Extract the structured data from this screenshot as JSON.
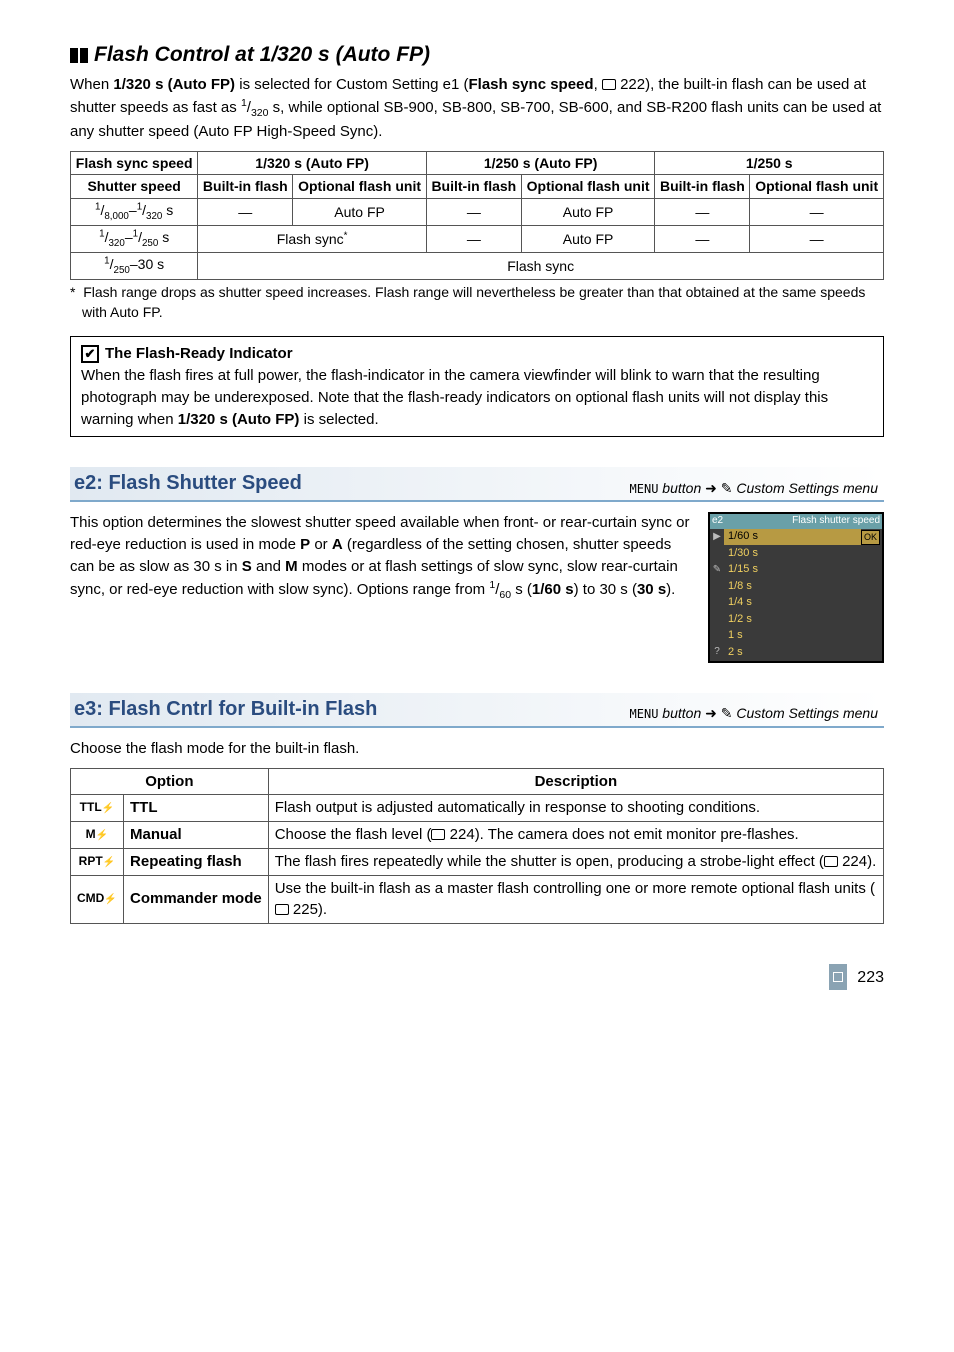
{
  "section1": {
    "title": "Flash Control at 1/320 s (Auto FP)",
    "para_parts": {
      "p1": "When ",
      "p2": " is selected for Custom Setting e1 (",
      "p3": ", ",
      "p4": " 222), the built-in flash can be used at shutter speeds as fast as ",
      "p5": " s, while optional SB-900, SB-800, SB-700, SB-600, and SB-R200 flash units can be used at any shutter speed (Auto FP High-Speed Sync).",
      "bold1": "1/320 s (Auto FP)",
      "bold2": "Flash sync speed",
      "frac_num": "1",
      "frac_den": "320"
    },
    "table": {
      "h_sync": "Flash sync speed",
      "h_shutter": "Shutter speed",
      "h_builtin": "Built-in flash",
      "h_optunit": "Optional flash unit",
      "c_auto320": "1/320 s (Auto FP)",
      "c_auto250": "1/250 s (Auto FP)",
      "c_250": "1/250 s",
      "r1_label_a": "1",
      "r1_label_b": "8,000",
      "r1_label_c": "1",
      "r1_label_d": "320",
      "r1_label_e": " s",
      "r2_label_a": "1",
      "r2_label_b": "320",
      "r2_label_c": "1",
      "r2_label_d": "250",
      "r2_label_e": " s",
      "r3_label_a": "1",
      "r3_label_b": "250",
      "r3_label_c": "–30 s",
      "dash": "—",
      "autoFP": "Auto FP",
      "flashsync": "Flash sync",
      "flashsync_star": "Flash sync"
    },
    "footnote_star": "*",
    "footnote": "Flash range drops as shutter speed increases.  Flash range will nevertheless be greater than that obtained at the same speeds with Auto FP."
  },
  "callout": {
    "title": "The Flash-Ready Indicator",
    "body_a": "When the flash fires at full power, the flash-indicator in the camera viewfinder will blink to warn that the resulting photograph may be underexposed.  Note that the flash-ready indicators on optional flash units will not display this warning when ",
    "body_bold": "1/320 s (Auto FP)",
    "body_b": " is selected."
  },
  "e2": {
    "name": "e2: Flash Shutter Speed",
    "loc_menu": "MENU",
    "loc_button": " button ",
    "loc_menu2": " Custom Settings menu",
    "para_a": "This option determines the slowest shutter speed available when front- or rear-curtain sync or red-eye reduction is used in mode ",
    "para_b": " or ",
    "para_c": " (regardless of the setting chosen, shutter speeds can be as slow as 30 s in ",
    "para_d": " and ",
    "para_e": " modes or at flash settings of slow sync, slow rear-curtain sync, or red-eye reduction with slow sync).  Options range from ",
    "P": "P",
    "A": "A",
    "S": "S",
    "M": "M",
    "frac_num": "1",
    "frac_den": "60",
    "para_f": " s (",
    "bold1": "1/60 s",
    "para_g": ") to 30 s (",
    "bold2": "30 s",
    "para_h": ").",
    "lcd": {
      "tag": "e2",
      "title": "Flash shutter speed",
      "items": [
        "1/60 s",
        "1/30 s",
        "1/15 s",
        "1/8 s",
        "1/4 s",
        "1/2 s",
        "1 s",
        "2 s"
      ],
      "ok": "OK"
    }
  },
  "e3": {
    "name": "e3: Flash Cntrl for Built-in Flash",
    "loc_menu": "MENU",
    "loc_button": " button ",
    "loc_menu2": " Custom Settings menu",
    "intro": "Choose the flash mode for the built-in flash.",
    "th_option": "Option",
    "th_desc": "Description",
    "rows": [
      {
        "code": "TTL",
        "label": "TTL",
        "desc": "Flash output is adjusted automatically in response to shooting conditions."
      },
      {
        "code": "M",
        "label": "Manual",
        "desc_a": "Choose the flash level (",
        "ref": " 224",
        "desc_b": "). The camera does not emit monitor pre-flashes."
      },
      {
        "code": "RPT",
        "label": "Repeating flash",
        "desc_a": "The flash fires repeatedly while the shutter is open, producing a strobe-light effect (",
        "ref": " 224",
        "desc_b": ")."
      },
      {
        "code": "CMD",
        "label": "Commander mode",
        "desc_a": "Use the built-in flash as a master flash controlling one or more remote optional flash units (",
        "ref": " 225",
        "desc_b": ")."
      }
    ]
  },
  "page_number": "223",
  "chart_data": {
    "type": "table",
    "title": "Flash Control at 1/320 s (Auto FP)",
    "columns": [
      "Shutter speed",
      "1/320 s (Auto FP) — Built-in flash",
      "1/320 s (Auto FP) — Optional flash unit",
      "1/250 s (Auto FP) — Built-in flash",
      "1/250 s (Auto FP) — Optional flash unit",
      "1/250 s — Built-in flash",
      "1/250 s — Optional flash unit"
    ],
    "rows": [
      [
        "1/8,000–1/320 s",
        "—",
        "Auto FP",
        "—",
        "Auto FP",
        "—",
        "—"
      ],
      [
        "1/320–1/250 s",
        "Flash sync*",
        "Flash sync*",
        "—",
        "Auto FP",
        "—",
        "—"
      ],
      [
        "1/250–30 s",
        "Flash sync",
        "Flash sync",
        "Flash sync",
        "Flash sync",
        "Flash sync",
        "Flash sync"
      ]
    ]
  }
}
